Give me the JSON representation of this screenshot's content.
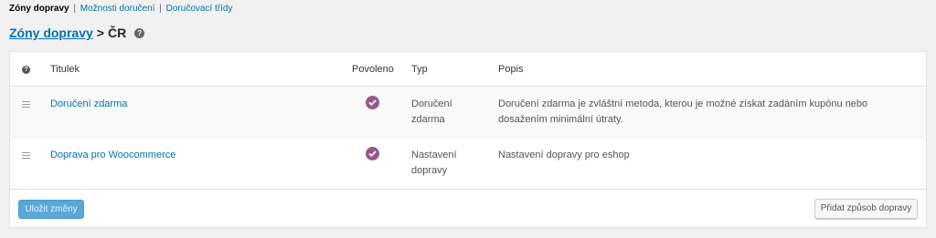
{
  "subnav": {
    "current": "Zóny dopravy",
    "separator": "|",
    "links": [
      "Možnosti doručení",
      "Doručovací třídy"
    ]
  },
  "heading": {
    "link": "Zóny dopravy",
    "separator": ">",
    "zone": "ČR"
  },
  "table": {
    "headers": {
      "title": "Titulek",
      "enabled": "Povoleno",
      "type": "Typ",
      "description": "Popis"
    },
    "rows": [
      {
        "title": "Doručení zdarma",
        "enabled": true,
        "type": "Doručení zdarma",
        "description": "Doručení zdarma je zvláštní metoda, kterou je možné získat zadáním kupónu nebo dosažením minimální útraty."
      },
      {
        "title": "Doprava pro Woocommerce",
        "enabled": true,
        "type": "Nastavení dopravy",
        "description": "Nastavení dopravy pro eshop"
      }
    ]
  },
  "footer": {
    "save_label": "Uložit změny",
    "add_label": "Přidat způsob dopravy"
  },
  "colors": {
    "link": "#0073aa",
    "check": "#96588a",
    "primary_button": "#58a8d8"
  },
  "icons": [
    "help-icon",
    "drag-handle-icon",
    "checkmark-icon"
  ]
}
